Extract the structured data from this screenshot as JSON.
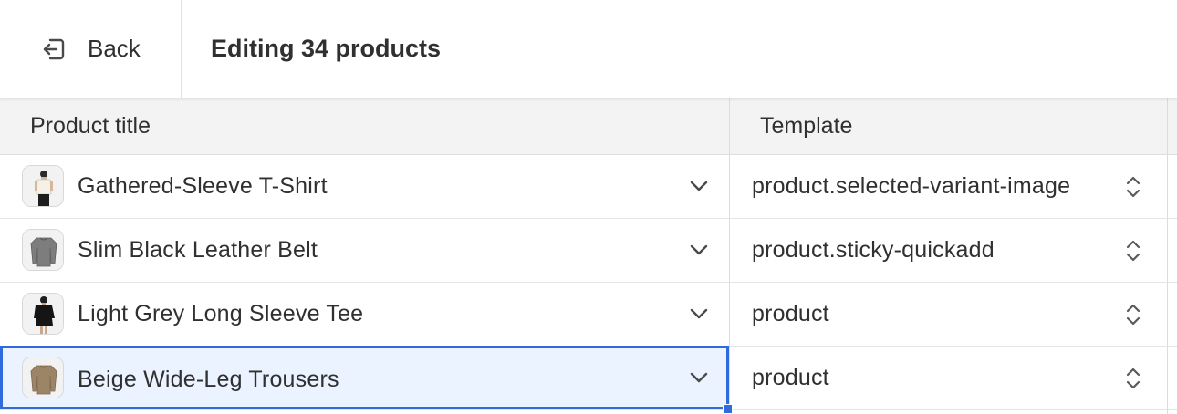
{
  "header": {
    "back_label": "Back",
    "title": "Editing 34 products"
  },
  "columns": {
    "product_title": "Product title",
    "template": "Template"
  },
  "rows": [
    {
      "title": "Gathered-Sleeve T-Shirt",
      "template": "product.selected-variant-image",
      "thumb": "woman-white-top"
    },
    {
      "title": "Slim Black Leather Belt",
      "template": "product.sticky-quickadd",
      "thumb": "grey-sweater"
    },
    {
      "title": "Light Grey Long Sleeve Tee",
      "template": "product",
      "thumb": "woman-black-top"
    },
    {
      "title": "Beige Wide-Leg Trousers",
      "template": "product",
      "thumb": "beige-sweater"
    }
  ],
  "colors": {
    "selection": "#2f6bdd",
    "selection_fill": "#eaf3ff",
    "header_bg": "#f3f3f3",
    "text": "#303030"
  }
}
